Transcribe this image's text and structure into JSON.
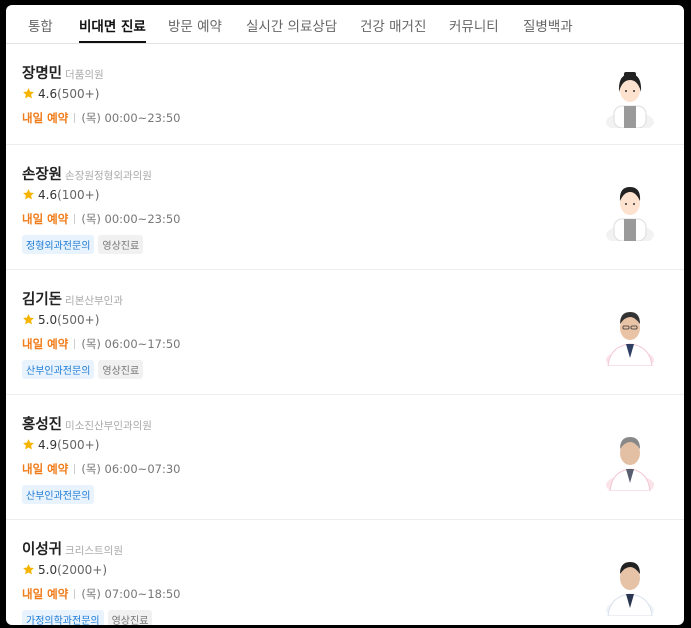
{
  "tabs": [
    "통합",
    "비대면 진료",
    "방문 예약",
    "실시간 의료상담",
    "건강 매거진",
    "커뮤니티",
    "질병백과"
  ],
  "active_tab": "비대면 진료",
  "colors": {
    "accent": "#f07c1a",
    "star": "#f5b400",
    "tag_blue": "#1e7bd6"
  },
  "doctors": [
    {
      "name": "장명민",
      "clinic": "더품의원",
      "rating": "4.6",
      "reviews": "(500+)",
      "schedule_label": "내일 예약",
      "schedule": "(목) 00:00~23:50",
      "tags": [],
      "avatar": "female-doctor-illustration"
    },
    {
      "name": "손장원",
      "clinic": "손장원정형외과의원",
      "rating": "4.6",
      "reviews": "(100+)",
      "schedule_label": "내일 예약",
      "schedule": "(목) 00:00~23:50",
      "tags": [
        "정형외과전문의",
        "영상진료"
      ],
      "avatar": "male-doctor-illustration"
    },
    {
      "name": "김기돈",
      "clinic": "리본산부인과",
      "rating": "5.0",
      "reviews": "(500+)",
      "schedule_label": "내일 예약",
      "schedule": "(목) 06:00~17:50",
      "tags": [
        "산부인과전문의",
        "영상진료"
      ],
      "avatar": "doctor-photo"
    },
    {
      "name": "홍성진",
      "clinic": "미소진산부인과의원",
      "rating": "4.9",
      "reviews": "(500+)",
      "schedule_label": "내일 예약",
      "schedule": "(목) 06:00~07:30",
      "tags": [
        "산부인과전문의"
      ],
      "avatar": "doctor-photo"
    },
    {
      "name": "이성귀",
      "clinic": "크리스트의원",
      "rating": "5.0",
      "reviews": "(2000+)",
      "schedule_label": "내일 예약",
      "schedule": "(목) 07:00~18:50",
      "tags": [
        "가정의학과전문의",
        "영상진료"
      ],
      "avatar": "doctor-photo"
    }
  ]
}
